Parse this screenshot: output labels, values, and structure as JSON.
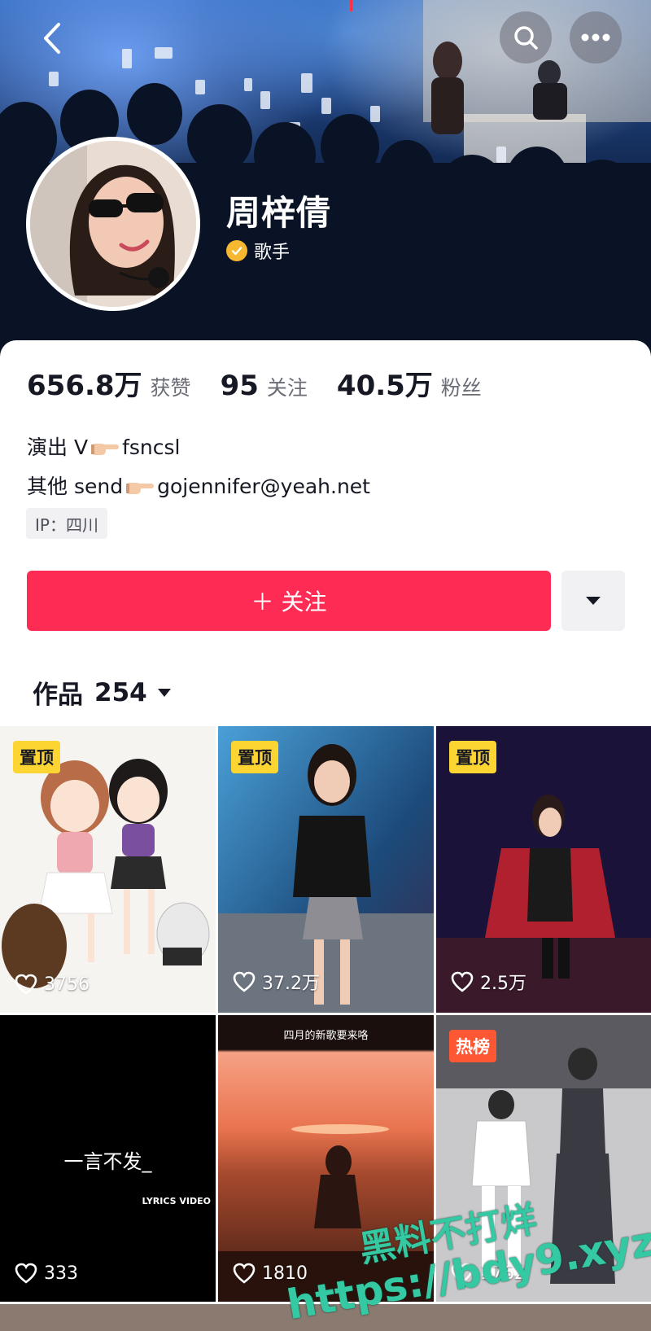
{
  "profile": {
    "name": "周梓倩",
    "verify_label": "歌手"
  },
  "stats": [
    {
      "value": "656.8万",
      "label": "获赞"
    },
    {
      "value": "95",
      "label": "关注"
    },
    {
      "value": "40.5万",
      "label": "粉丝"
    }
  ],
  "bio": {
    "line1_prefix": "演出 V",
    "line1_suffix": "fsncsl",
    "line2_prefix": "其他 send",
    "line2_suffix": "gojennifer@yeah.net"
  },
  "ip_tag": "IP：四川",
  "actions": {
    "follow_label": "＋ 关注"
  },
  "works": {
    "label": "作品",
    "count": "254"
  },
  "tiles": [
    {
      "badge": "置顶",
      "badge_type": "top",
      "likes": "3756"
    },
    {
      "badge": "置顶",
      "badge_type": "top",
      "likes": "37.2万"
    },
    {
      "badge": "置顶",
      "badge_type": "top",
      "likes": "2.5万"
    },
    {
      "badge": "",
      "badge_type": "",
      "likes": "333",
      "title": "一言不发_",
      "subtitle": "LYRICS VIDEO"
    },
    {
      "badge": "",
      "badge_type": "",
      "likes": "1810",
      "top_text": "四月的新歌要来咯"
    },
    {
      "badge": "热榜",
      "badge_type": "hot",
      "likes": "1762"
    }
  ],
  "watermark": {
    "line1": "黑料不打烊",
    "line2": "https://bdy9.xyz"
  },
  "colors": {
    "follow": "#fe2c55",
    "badge_top": "#fcd533",
    "badge_hot": "#fe5733",
    "verify": "#f7b731"
  }
}
